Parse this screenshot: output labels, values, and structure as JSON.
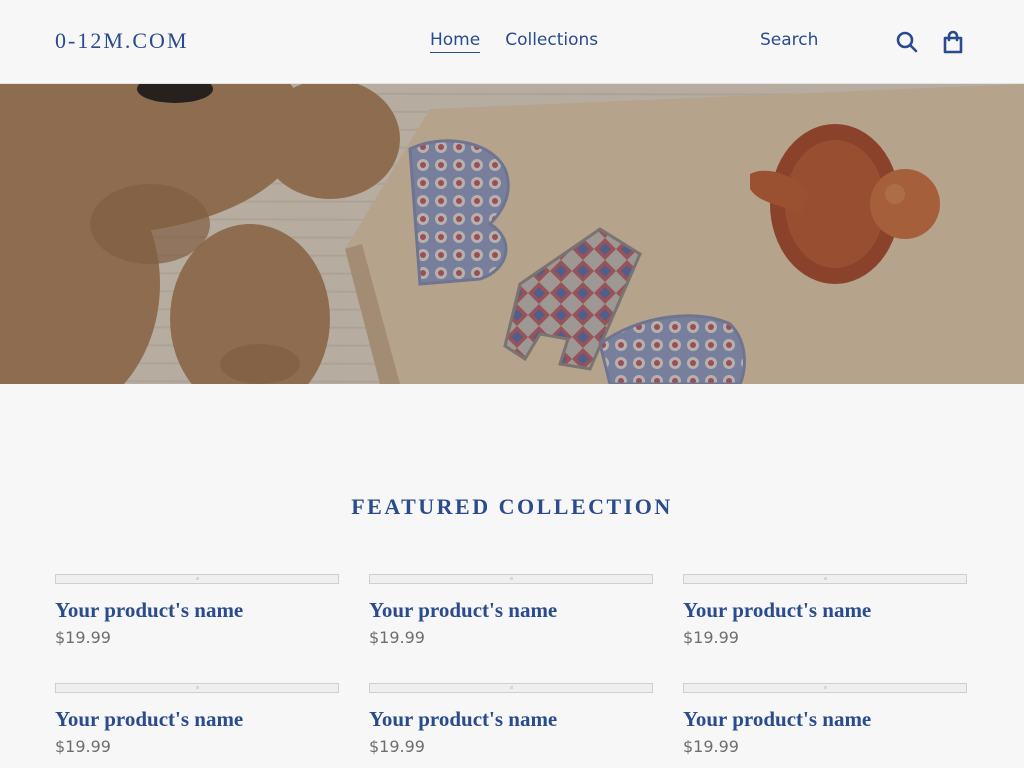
{
  "header": {
    "logo": "0-12M.COM",
    "nav": [
      {
        "label": "Home",
        "active": true
      },
      {
        "label": "Collections",
        "active": false
      }
    ],
    "search_label": "Search",
    "search_icon": "search-icon",
    "cart_icon": "cart-icon"
  },
  "hero": {
    "image": "teddy bear, wooden letters and pacifier"
  },
  "featured": {
    "title": "Featured collection",
    "products": [
      {
        "name": "Your product's name",
        "price": "$19.99"
      },
      {
        "name": "Your product's name",
        "price": "$19.99"
      },
      {
        "name": "Your product's name",
        "price": "$19.99"
      },
      {
        "name": "Your product's name",
        "price": "$19.99"
      },
      {
        "name": "Your product's name",
        "price": "$19.99"
      },
      {
        "name": "Your product's name",
        "price": "$19.99"
      }
    ]
  },
  "colors": {
    "brand": "#2a4b8d",
    "background": "#f7f7f7",
    "price": "#6e6e6e"
  }
}
